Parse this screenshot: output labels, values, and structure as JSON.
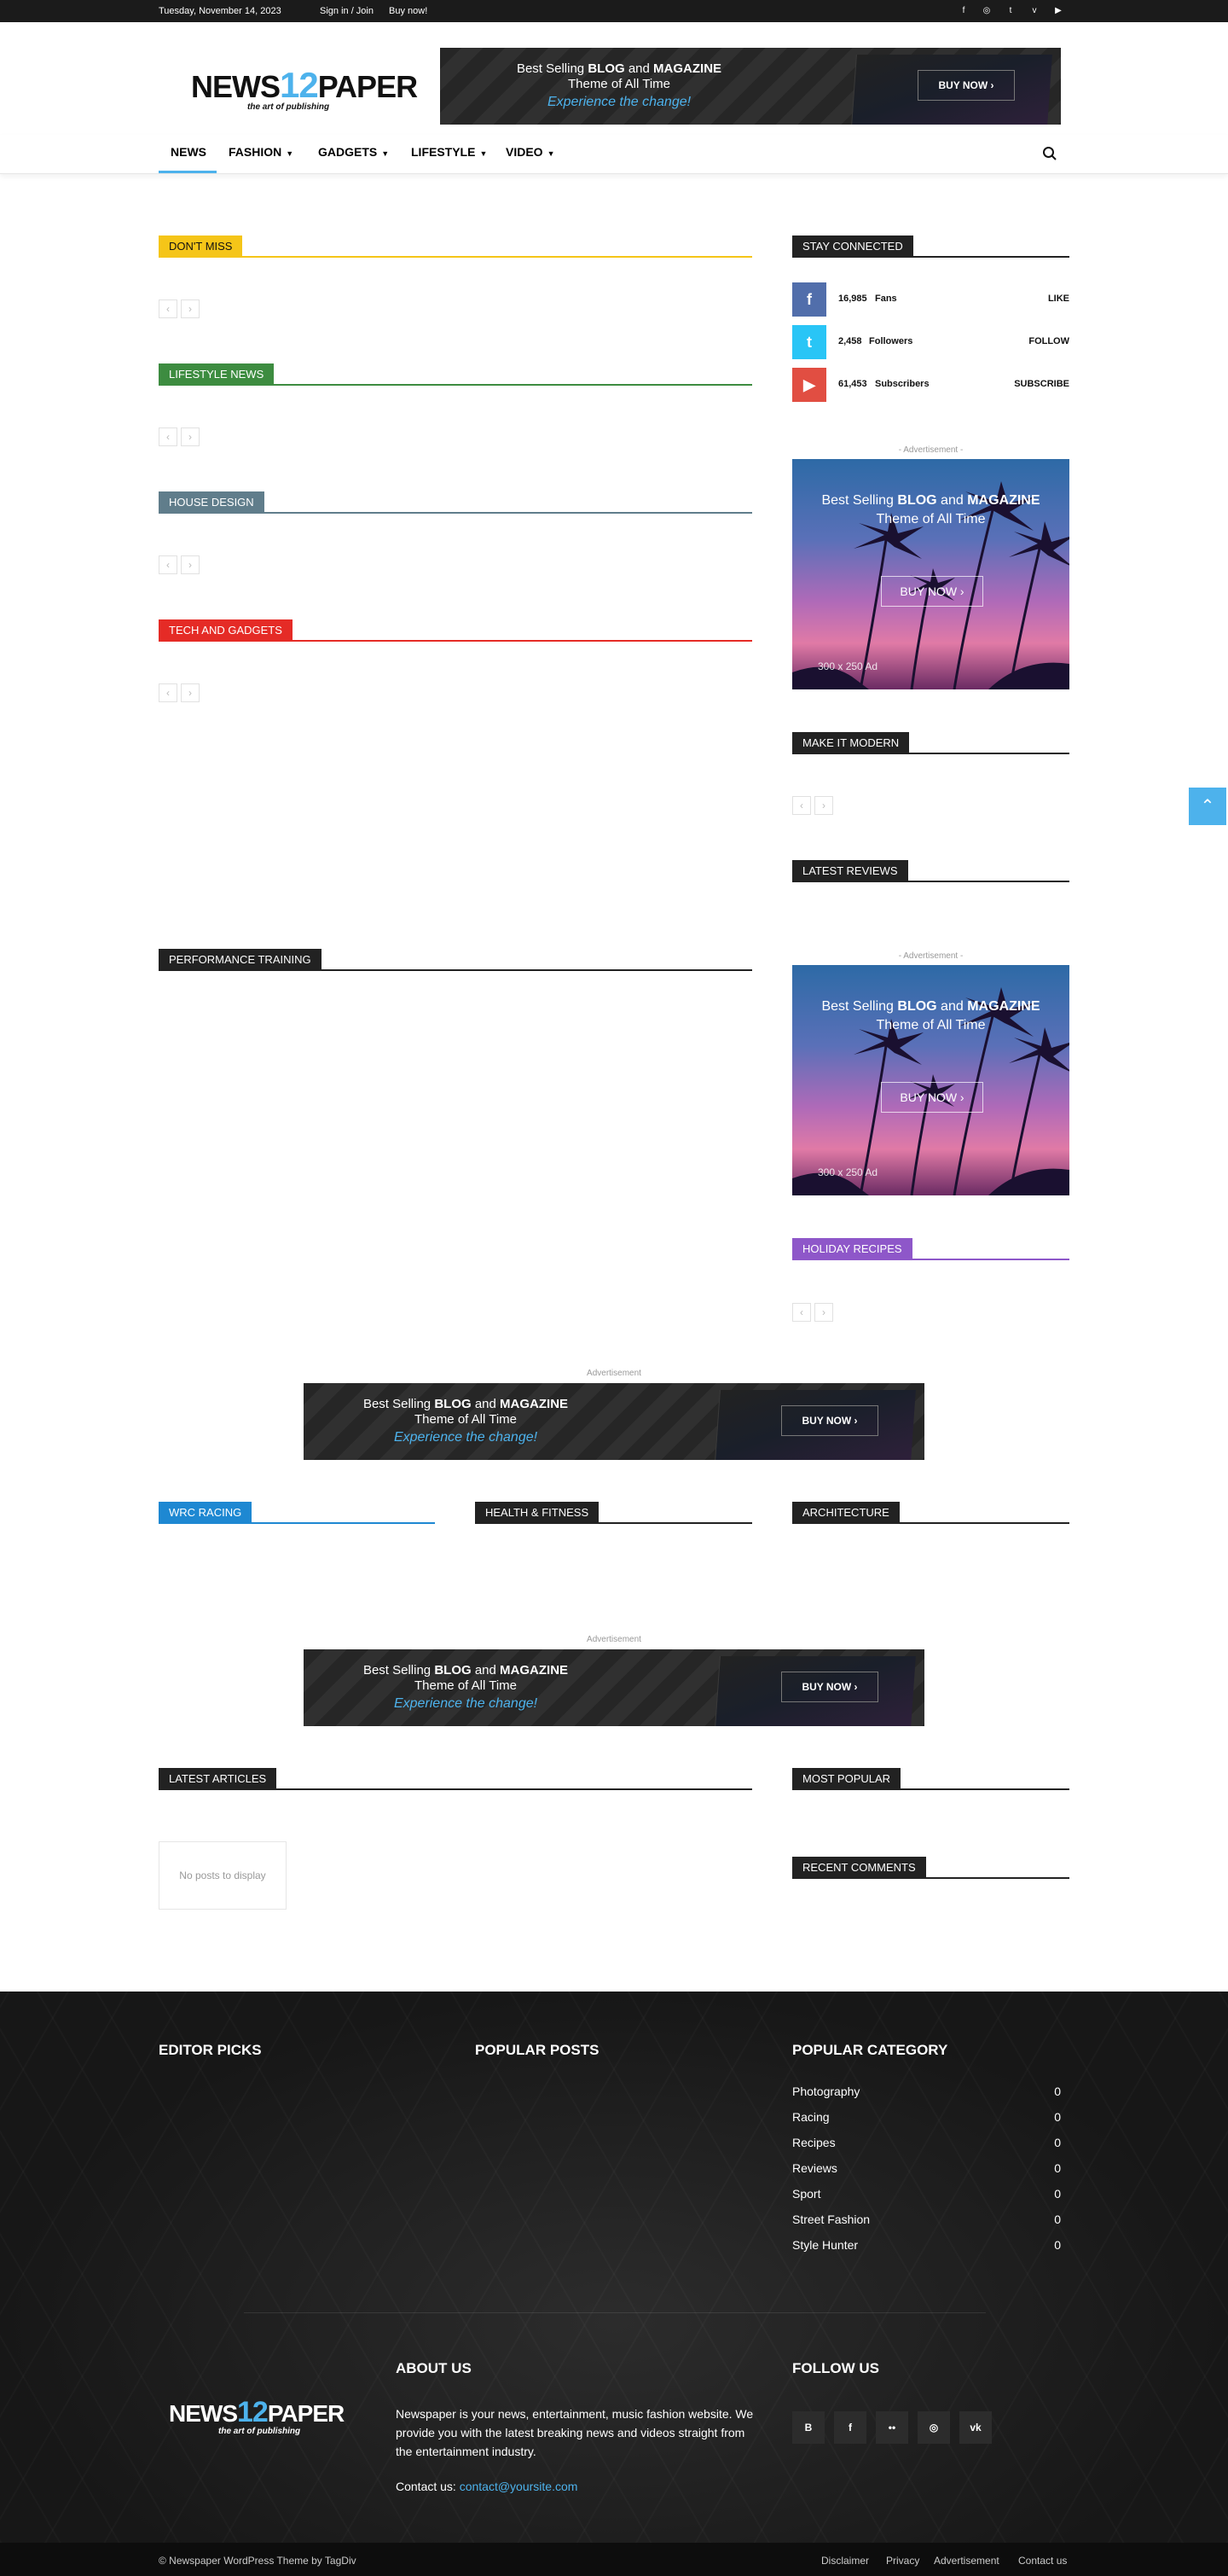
{
  "topbar": {
    "date": "Tuesday, November 14, 2023",
    "signin": "Sign in / Join",
    "buynow": "Buy now!",
    "social": [
      "f",
      "◎",
      "t",
      "v",
      "▶"
    ]
  },
  "header": {
    "logo_left": "NEWS",
    "logo_num": "12",
    "logo_right": "PAPER",
    "logo_tagline": "the art of publishing"
  },
  "banner": {
    "line1_a": "Best Selling ",
    "line1_b": "BLOG",
    "line1_c": " and ",
    "line1_d": "MAGAZINE",
    "line2": "Theme of All Time",
    "line3": "Experience the change!",
    "button": "BUY NOW ›"
  },
  "nav": {
    "items": [
      {
        "label": "NEWS"
      },
      {
        "label": "FASHION"
      },
      {
        "label": "GADGETS"
      },
      {
        "label": "LIFESTYLE"
      },
      {
        "label": "VIDEO"
      }
    ]
  },
  "blocks": {
    "dont_miss": "DON'T MISS",
    "lifestyle_news": "LIFESTYLE NEWS",
    "house_design": "HOUSE DESIGN",
    "tech_gadgets": "TECH AND GADGETS",
    "performance": "PERFORMANCE TRAINING",
    "stay_connected": "STAY CONNECTED",
    "make_modern": "MAKE IT MODERN",
    "latest_reviews": "LATEST REVIEWS",
    "holiday_recipes": "HOLIDAY RECIPES",
    "wrc_racing": "WRC RACING",
    "health_fitness": "HEALTH & FITNESS",
    "architecture": "ARCHITECTURE",
    "latest_articles": "LATEST ARTICLES",
    "most_popular": "MOST POPULAR",
    "recent_comments": "RECENT COMMENTS"
  },
  "colors": {
    "accent": "#4db2ec",
    "dont_miss": "#f5c518",
    "lifestyle": "#3d8c40",
    "house": "#607d8b",
    "tech": "#e52b26",
    "wrc": "#1e88d2",
    "holiday": "#8e57c9"
  },
  "social_counters": [
    {
      "icon": "f",
      "count": "16,985",
      "unit": "Fans",
      "action": "LIKE",
      "color": "#516eab"
    },
    {
      "icon": "t",
      "count": "2,458",
      "unit": "Followers",
      "action": "FOLLOW",
      "color": "#29c5f6"
    },
    {
      "icon": "▶",
      "count": "61,453",
      "unit": "Subscribers",
      "action": "SUBSCRIBE",
      "color": "#e14e42"
    }
  ],
  "ads": {
    "label_dash": "- Advertisement -",
    "label": "Advertisement",
    "square_line1_a": "Best Selling ",
    "square_line1_b": "BLOG",
    "square_line1_c": " and ",
    "square_line1_d": "MAGAZINE",
    "square_line2": "Theme of All Time",
    "square_button": "BUY NOW  ›",
    "square_size": "300 x 250 Ad"
  },
  "pager": {
    "prev": "‹",
    "next": "›"
  },
  "latest_articles": {
    "empty": "No posts to display"
  },
  "footer": {
    "editor_picks": "EDITOR PICKS",
    "popular_posts": "POPULAR POSTS",
    "popular_category": "POPULAR CATEGORY",
    "categories": [
      {
        "name": "Photography",
        "count": "0"
      },
      {
        "name": "Racing",
        "count": "0"
      },
      {
        "name": "Recipes",
        "count": "0"
      },
      {
        "name": "Reviews",
        "count": "0"
      },
      {
        "name": "Sport",
        "count": "0"
      },
      {
        "name": "Street Fashion",
        "count": "0"
      },
      {
        "name": "Style Hunter",
        "count": "0"
      }
    ],
    "about_title": "ABOUT US",
    "about_text": "Newspaper is your news, entertainment, music fashion website. We provide you with the latest breaking news and videos straight from the entertainment industry.",
    "contact_label": "Contact us: ",
    "contact_email": "contact@yoursite.com",
    "follow_title": "FOLLOW US",
    "follow_icons": [
      "B",
      "f",
      "••",
      "◎",
      "vk"
    ]
  },
  "subfooter": {
    "copyright": "© Newspaper WordPress Theme by TagDiv",
    "links": [
      "Disclaimer",
      "Privacy",
      "Advertisement",
      "Contact us"
    ]
  },
  "to_top": "⌃"
}
